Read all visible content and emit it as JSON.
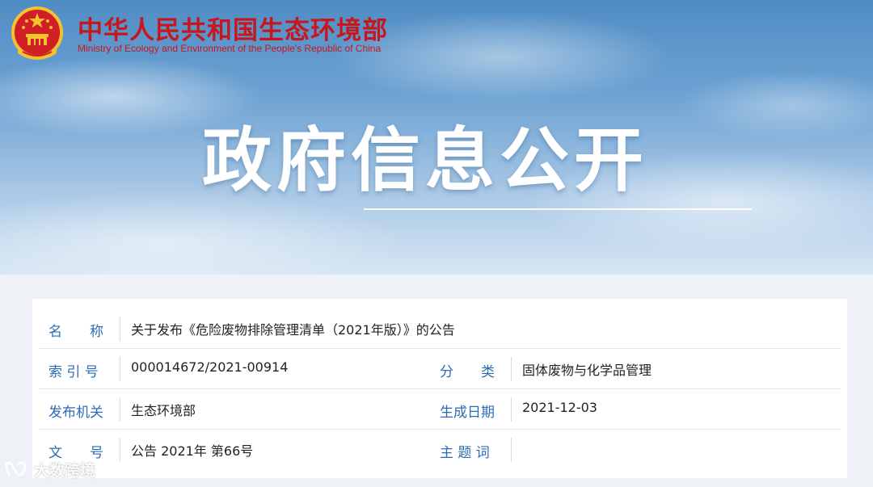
{
  "header": {
    "site_name": "中华人民共和国生态环境部",
    "site_name_en": "Ministry of Ecology and Environment of the People's Republic of China",
    "emblem_icon": "national-emblem-icon"
  },
  "banner": {
    "title": "政府信息公开"
  },
  "info": {
    "name": {
      "label": "名　　称",
      "value": "关于发布《危险废物排除管理清单（2021年版）》的公告"
    },
    "index_no": {
      "label": "索 引 号",
      "value": "000014672/2021-00914"
    },
    "category": {
      "label": "分　　类",
      "value": "固体废物与化学品管理"
    },
    "publisher": {
      "label": "发布机关",
      "value": "生态环境部"
    },
    "date": {
      "label": "生成日期",
      "value": "2021-12-03"
    },
    "doc_no": {
      "label": "文　　号",
      "value": "公告 2021年 第66号"
    },
    "subject": {
      "label": "主 题 词",
      "value": ""
    }
  },
  "watermark": {
    "text": "大数跨境",
    "icon": "wechat-channel-icon"
  },
  "colors": {
    "brand_red": "#c8161d",
    "label_blue": "#2b6cb3",
    "banner_blue": "#4f8cc4"
  }
}
